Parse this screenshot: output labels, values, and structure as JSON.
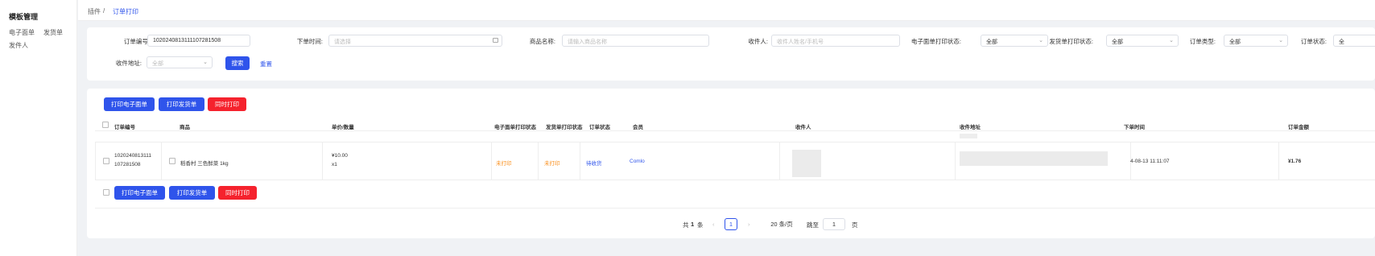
{
  "sidebar": {
    "title": "模板管理",
    "items": [
      {
        "label": "电子面单"
      },
      {
        "label": "发货单"
      },
      {
        "label": "发件人"
      }
    ]
  },
  "breadcrumb": {
    "root": "插件",
    "separator": "/",
    "current": "订单打印"
  },
  "filters": {
    "order_no": {
      "label": "订单编号:",
      "value": "1020240813111107281508"
    },
    "order_time": {
      "label": "下单时间:",
      "placeholder": "请选择"
    },
    "product_name": {
      "label": "商品名称:",
      "placeholder": "请输入商品名称"
    },
    "receiver": {
      "label": "收件人:",
      "placeholder": "收件人姓名/手机号"
    },
    "waybill_status": {
      "label": "电子面单打印状态:",
      "value": "全部"
    },
    "invoice_status": {
      "label": "发货单打印状态:",
      "value": "全部"
    },
    "order_type": {
      "label": "订单类型:",
      "value": "全部"
    },
    "order_status": {
      "label": "订单状态:",
      "value": "全"
    },
    "address": {
      "label": "收件地址:",
      "value": "全部"
    },
    "search_label": "搜索",
    "reset_label": "重置"
  },
  "actions": {
    "print_waybill": "打印电子面单",
    "print_invoice": "打印发货单",
    "print_both": "同时打印"
  },
  "table": {
    "headers": [
      "订单编号",
      "商品",
      "单价/数量",
      "电子面单打印状态",
      "发货单打印状态",
      "订单状态",
      "会员",
      "收件人",
      "收件地址",
      "下单时间",
      "订单金额"
    ],
    "rows": [
      {
        "order_no_line1": "1020240813111",
        "order_no_line2": "107281508",
        "product": "稻香村 三色鲜菜 1kg",
        "price": "¥10.00",
        "qty": "x1",
        "waybill_status": "未打印",
        "invoice_status": "未打印",
        "order_status": "待收货",
        "member": "Comlo",
        "order_time": "4-08-13 11:11:07",
        "amount": "¥1.76"
      }
    ]
  },
  "pagination": {
    "total_prefix": "共",
    "total": "1",
    "total_suffix": "条",
    "current_page": "1",
    "page_size": "20 条/页",
    "goto_label": "跳至",
    "goto_value": "1",
    "goto_suffix": "页"
  }
}
